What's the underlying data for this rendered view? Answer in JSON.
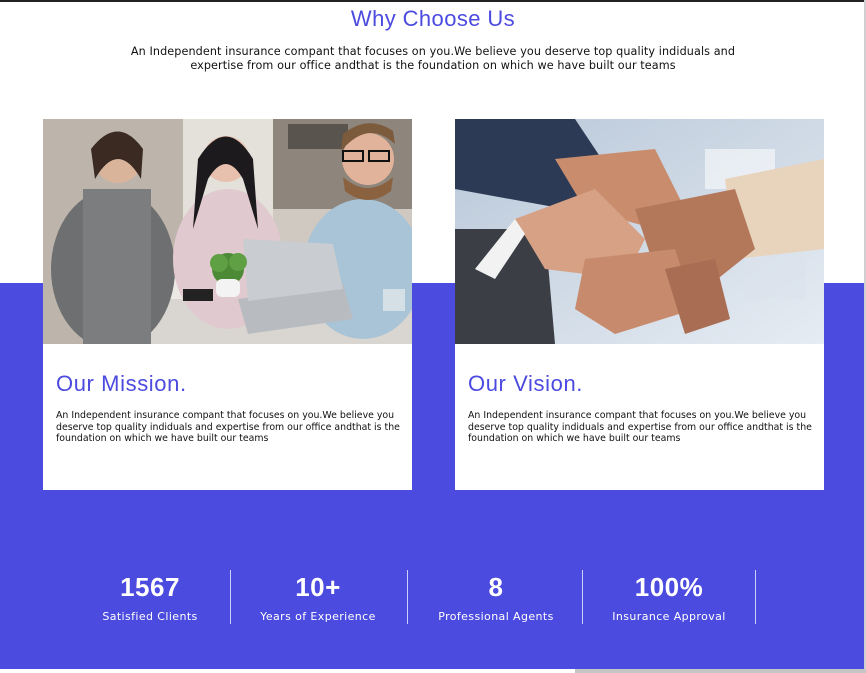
{
  "section": {
    "title": "Why Choose Us",
    "intro": "An Independent insurance compant that focuses on you.We believe you deserve top quality indiduals and expertise from our office andthat is the foundation on which we have built our teams"
  },
  "cards": [
    {
      "title": "Our Mission.",
      "text": "An Independent insurance compant that focuses on you.We believe you deserve top quality indiduals and expertise from our office andthat is the foundation on which we have built our teams"
    },
    {
      "title": "Our Vision.",
      "text": "An Independent insurance compant that focuses on you.We believe you deserve top quality indiduals and expertise from our office andthat is the foundation on which we have built our teams"
    }
  ],
  "stats": [
    {
      "value": "1567",
      "label": "Satisfied Clients"
    },
    {
      "value": "10+",
      "label": "Years of Experience"
    },
    {
      "value": "8",
      "label": "Professional Agents"
    },
    {
      "value": "100%",
      "label": "Insurance Approval"
    }
  ],
  "colors": {
    "accent": "#4c4bdf",
    "text": "#111111",
    "background": "#ffffff"
  }
}
